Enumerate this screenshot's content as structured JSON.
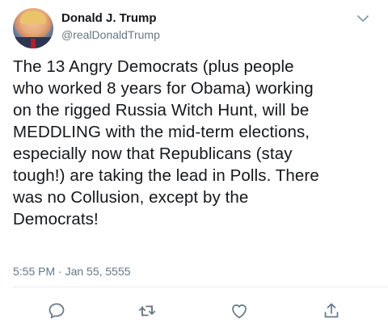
{
  "author": {
    "display_name": "Donald J. Trump",
    "handle": "@realDonaldTrump"
  },
  "tweet": {
    "lines": [
      "The 13 Angry Democrats (plus people",
      "who worked 8 years for Obama) working",
      "on the rigged Russia Witch Hunt, will be",
      "MEDDLING with the mid-term elections,",
      "especially now that Republicans (stay",
      "tough!) are taking the lead in Polls. There",
      "was no Collusion, except by the",
      "Democrats!"
    ],
    "timestamp": "5:55 PM · Jan 55, 5555"
  },
  "actions": {
    "icons": [
      "reply-icon",
      "retweet-icon",
      "like-icon",
      "share-icon"
    ]
  },
  "colors": {
    "text": "#14171a",
    "secondary": "#657786",
    "icon": "#657786",
    "divider": "#e6ecf0"
  }
}
